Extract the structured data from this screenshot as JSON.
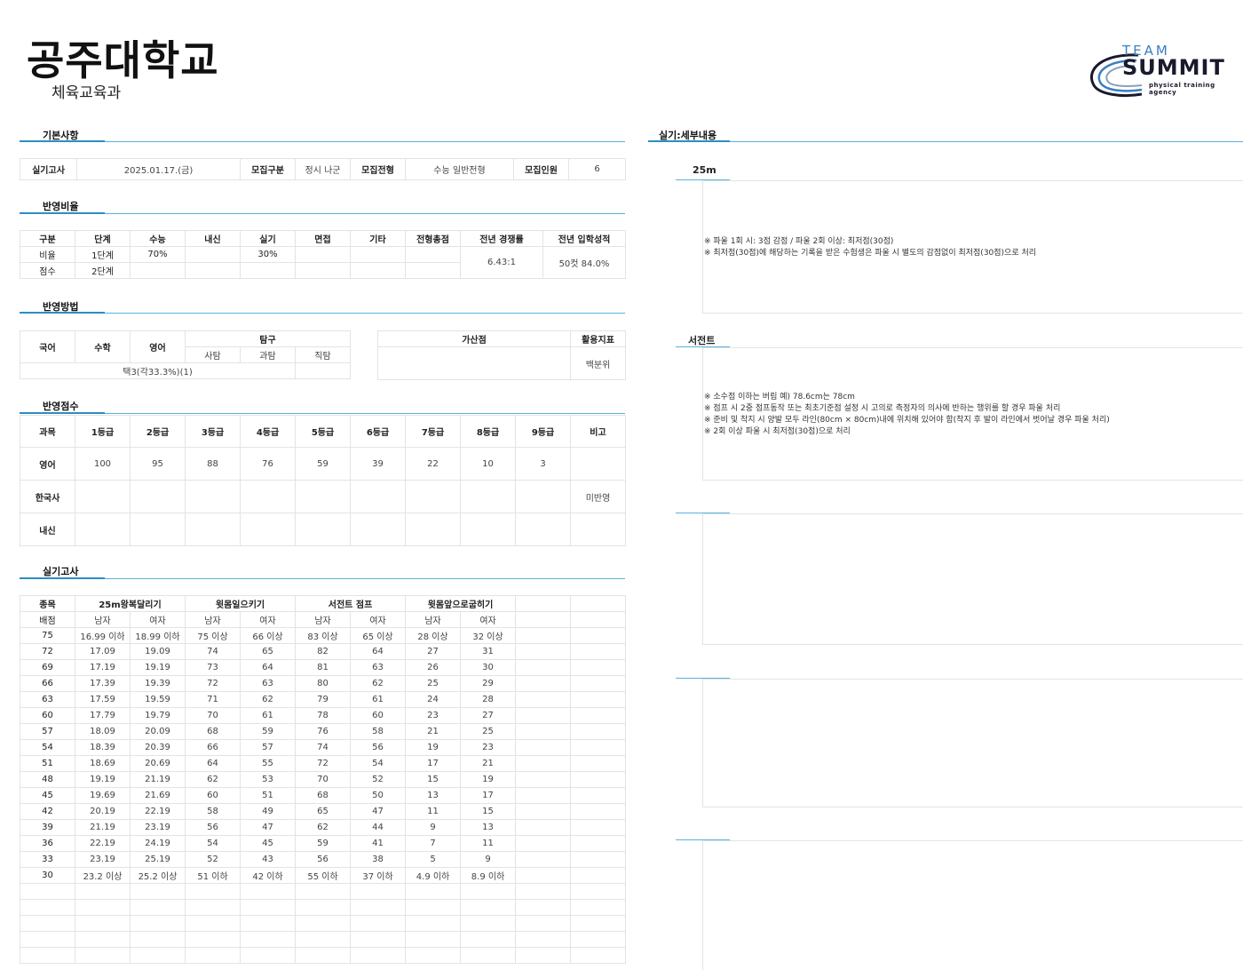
{
  "header": {
    "university": "공주대학교",
    "department": "체육교육과",
    "logo": {
      "team": "TEAM",
      "summit": "SUMMIT",
      "tagline": "physical training agency"
    }
  },
  "sections": {
    "basic": "기본사항",
    "ratio": "반영비율",
    "method": "반영방법",
    "score": "반영점수",
    "practical": "실기고사",
    "detail": "실기:세부내용"
  },
  "basic": {
    "exam_label": "실기고사",
    "exam_date": "2025.01.17.(금)",
    "group_label": "모집구분",
    "group_value": "정시 나군",
    "type_label": "모집전형",
    "type_value": "수능 일반전형",
    "count_label": "모집인원",
    "count_value": "6"
  },
  "ratio": {
    "headers": [
      "구분",
      "단계",
      "수능",
      "내신",
      "실기",
      "면접",
      "기타",
      "전형총점",
      "전년 경쟁률",
      "전년 입학성적"
    ],
    "row1": {
      "label": "비율",
      "stage": "1단계",
      "suneung": "70%",
      "naesin": "",
      "silgi": "30%"
    },
    "row2": {
      "label": "점수",
      "stage": "2단계"
    },
    "competition": "6.43:1",
    "admission": "50컷 84.0%"
  },
  "method": {
    "korean": "국어",
    "math": "수학",
    "english": "영어",
    "inquiry": "탐구",
    "social": "사탐",
    "science": "과탐",
    "vocational": "직탐",
    "select": "택3(각33.3%)(1)",
    "bonus": "가산점",
    "indicator": "활용지표",
    "indicator_value": "백분위"
  },
  "score": {
    "headers": [
      "과목",
      "1등급",
      "2등급",
      "3등급",
      "4등급",
      "5등급",
      "6등급",
      "7등급",
      "8등급",
      "9등급",
      "비고"
    ],
    "rows": [
      {
        "subject": "영어",
        "values": [
          "100",
          "95",
          "88",
          "76",
          "59",
          "39",
          "22",
          "10",
          "3"
        ],
        "note": ""
      },
      {
        "subject": "한국사",
        "values": [
          "",
          "",
          "",
          "",
          "",
          "",
          "",
          "",
          ""
        ],
        "note": "미반영"
      },
      {
        "subject": "내신",
        "values": [
          "",
          "",
          "",
          "",
          "",
          "",
          "",
          "",
          ""
        ],
        "note": ""
      }
    ]
  },
  "practical": {
    "event_label": "종목",
    "points_label": "배점",
    "events": [
      "25m왕복달리기",
      "윗몸일으키기",
      "서전트 점프",
      "윗몸앞으로굽히기"
    ],
    "male": "남자",
    "female": "여자",
    "rows": [
      [
        "75",
        "16.99 이하",
        "18.99 이하",
        "75 이상",
        "66 이상",
        "83 이상",
        "65 이상",
        "28 이상",
        "32 이상"
      ],
      [
        "72",
        "17.09",
        "19.09",
        "74",
        "65",
        "82",
        "64",
        "27",
        "31"
      ],
      [
        "69",
        "17.19",
        "19.19",
        "73",
        "64",
        "81",
        "63",
        "26",
        "30"
      ],
      [
        "66",
        "17.39",
        "19.39",
        "72",
        "63",
        "80",
        "62",
        "25",
        "29"
      ],
      [
        "63",
        "17.59",
        "19.59",
        "71",
        "62",
        "79",
        "61",
        "24",
        "28"
      ],
      [
        "60",
        "17.79",
        "19.79",
        "70",
        "61",
        "78",
        "60",
        "23",
        "27"
      ],
      [
        "57",
        "18.09",
        "20.09",
        "68",
        "59",
        "76",
        "58",
        "21",
        "25"
      ],
      [
        "54",
        "18.39",
        "20.39",
        "66",
        "57",
        "74",
        "56",
        "19",
        "23"
      ],
      [
        "51",
        "18.69",
        "20.69",
        "64",
        "55",
        "72",
        "54",
        "17",
        "21"
      ],
      [
        "48",
        "19.19",
        "21.19",
        "62",
        "53",
        "70",
        "52",
        "15",
        "19"
      ],
      [
        "45",
        "19.69",
        "21.69",
        "60",
        "51",
        "68",
        "50",
        "13",
        "17"
      ],
      [
        "42",
        "20.19",
        "22.19",
        "58",
        "49",
        "65",
        "47",
        "11",
        "15"
      ],
      [
        "39",
        "21.19",
        "23.19",
        "56",
        "47",
        "62",
        "44",
        "9",
        "13"
      ],
      [
        "36",
        "22.19",
        "24.19",
        "54",
        "45",
        "59",
        "41",
        "7",
        "11"
      ],
      [
        "33",
        "23.19",
        "25.19",
        "52",
        "43",
        "56",
        "38",
        "5",
        "9"
      ],
      [
        "30",
        "23.2 이상",
        "25.2 이상",
        "51 이하",
        "42 이하",
        "55 이하",
        "37 이하",
        "4.9 이하",
        "8.9 이하"
      ]
    ]
  },
  "detail": {
    "run_title": "25m",
    "run_notes": [
      "※ 파울 1회 시: 3점 감점 / 파울 2회 이상: 최저점(30점)",
      "※ 최저점(30점)에 해당하는 기록을 받은 수험생은 파울 시 별도의 감점없이 최저점(30점)으로 처리"
    ],
    "jump_title": "서전트",
    "jump_notes": [
      "※ 소수점 이하는 버림   예) 78.6cm는 78cm",
      "※ 점프 시 2중 점프동작 또는 최초기준점 설정 시 고의로 측정자의 의사에 반하는 행위를 할 경우 파울 처리",
      "※ 준비 및 착지 시 양발 모두 라인(80cm × 80cm)내에 위치해 있어야 함(착지 후 발이 라인에서 벗어날 경우 파울 처리)",
      "※ 2회 이상 파울 시 최저점(30점)으로 처리"
    ]
  },
  "colors": {
    "accent_line": "#5ab2dc",
    "accent_mark": "#2a8ec4",
    "logo_blue": "#3a7fc0",
    "flag_red": "#dd2222"
  }
}
